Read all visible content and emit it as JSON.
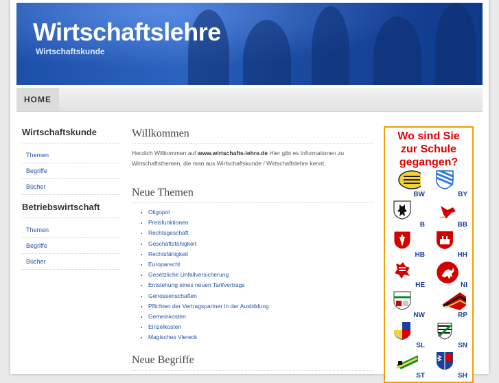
{
  "header": {
    "title": "Wirtschaftslehre",
    "subtitle": "Wirtschaftskunde"
  },
  "nav": {
    "home": "HOME"
  },
  "sidebar": {
    "sections": [
      {
        "title": "Wirtschaftskunde",
        "items": [
          "Themen",
          "Begriffe",
          "Bücher"
        ]
      },
      {
        "title": "Betriebswirtschaft",
        "items": [
          "Themen",
          "Begriffe",
          "Bücher"
        ]
      }
    ]
  },
  "main": {
    "welcome_title": "Willkommen",
    "intro_prefix": "Herzlich Willkommen auf ",
    "intro_site": "www.wirtschafts-lehre.de",
    "intro_suffix": " Hier gibt es Informationen zu Wirtschaftsthemen, die man aus Wirtschaftskunde / Wirtschaftslehre kennt.",
    "themes_title": "Neue Themen",
    "themes": [
      "Oligopol",
      "Preisfunktionen",
      "Rechtsgeschäft",
      "Geschäftsfähigkeit",
      "Rechtsfähigkeit",
      "Europarecht",
      "Gesetzliche Unfallversicherung",
      "Entstehung eines neuen Tarifvertrags",
      "Genossenschaften",
      "Pflichten der Vertragspartner in der Ausbildung",
      "Gemeinkosten",
      "Einzelkosten",
      "Magisches Viereck"
    ],
    "terms_title": "Neue Begriffe"
  },
  "ad": {
    "title_line1": "Wo sind Sie",
    "title_line2": "zur Schule",
    "title_line3": "gegangen?",
    "states": [
      "BW",
      "BY",
      "B",
      "BB",
      "HB",
      "HH",
      "HE",
      "NI",
      "NW",
      "RP",
      "SL",
      "SN",
      "ST",
      "SH"
    ]
  },
  "colors": {
    "banner": "#1d4fa8",
    "link": "#2553a6",
    "ad_border": "#f0a000",
    "ad_title": "#e00000",
    "state_abbr": "#1b3f9a"
  }
}
